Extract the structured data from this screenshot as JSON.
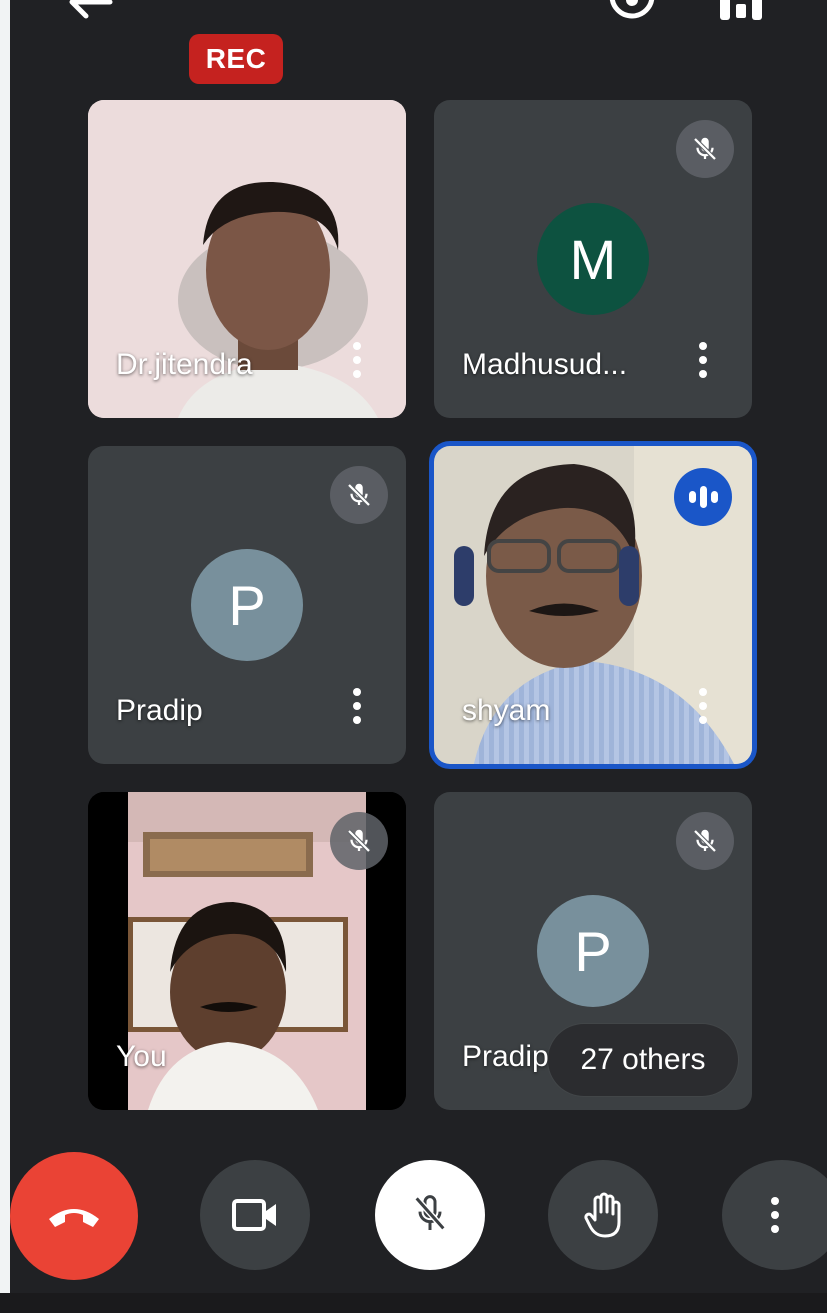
{
  "recording": {
    "label": "REC"
  },
  "tiles": [
    {
      "name": "Dr.jitendra",
      "type": "video"
    },
    {
      "name": "Madhusud...",
      "type": "avatar",
      "initial": "M",
      "avatar_color": "#0d5240",
      "muted": true
    },
    {
      "name": "Pradip",
      "type": "avatar",
      "initial": "P",
      "avatar_color": "#78909c",
      "muted": true
    },
    {
      "name": "shyam",
      "type": "video",
      "speaking": true
    },
    {
      "name": "You",
      "type": "video",
      "muted": true
    },
    {
      "name": "Pradip",
      "type": "avatar",
      "initial": "P",
      "avatar_color": "#78909c",
      "muted": true
    }
  ],
  "others": {
    "label": "27 others"
  },
  "controls": {
    "end_call_color": "#ea4335",
    "items": [
      "end-call-icon",
      "camera-icon",
      "mic-off-icon",
      "raise-hand-icon",
      "more-vert-icon"
    ]
  },
  "colors": {
    "background": "#202124",
    "tile": "#3c4043",
    "active_outline": "#1a56c8",
    "rec": "#c5221f"
  }
}
